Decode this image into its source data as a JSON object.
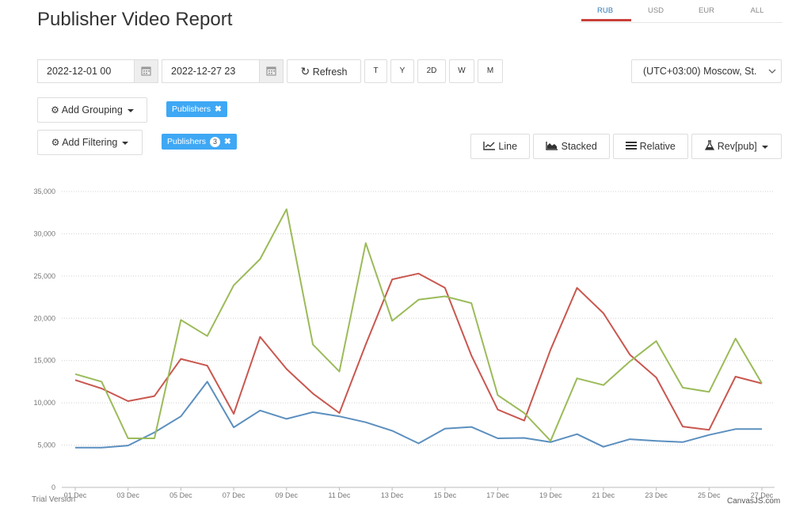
{
  "header": {
    "title": "Publisher Video Report"
  },
  "currency_tabs": [
    {
      "label": "RUB",
      "active": true
    },
    {
      "label": "USD",
      "active": false
    },
    {
      "label": "EUR",
      "active": false
    },
    {
      "label": "ALL",
      "active": false
    }
  ],
  "toolbar": {
    "date_from": "2022-12-01 00",
    "date_to": "2022-12-27 23",
    "refresh_label": "Refresh",
    "periods": [
      "T",
      "Y",
      "2D",
      "W",
      "M"
    ],
    "timezone": "(UTC+03:00) Moscow, St."
  },
  "grouping": {
    "button_label": "Add Grouping",
    "tag_label": "Publishers"
  },
  "filtering": {
    "button_label": "Add Filtering",
    "tag_label": "Publishers",
    "tag_count": "3"
  },
  "view_modes": {
    "line": "Line",
    "stacked": "Stacked",
    "relative": "Relative",
    "metric": "Rev[pub]"
  },
  "footer": {
    "trial": "Trial Version",
    "credit": "CanvasJS.com"
  },
  "colors": {
    "accent": "#c9403a",
    "tag_bg": "#3ea8f5",
    "link": "#337ab7"
  },
  "chart_data": {
    "type": "line",
    "x_tick_labels": [
      "01 Dec",
      "03 Dec",
      "05 Dec",
      "07 Dec",
      "09 Dec",
      "11 Dec",
      "13 Dec",
      "15 Dec",
      "17 Dec",
      "19 Dec",
      "21 Dec",
      "23 Dec",
      "25 Dec",
      "27 Dec"
    ],
    "y_tick_labels": [
      "0",
      "5,000",
      "10,000",
      "15,000",
      "20,000",
      "25,000",
      "30,000",
      "35,000"
    ],
    "ylim": [
      0,
      35000
    ],
    "grid": true,
    "x": [
      1,
      2,
      3,
      4,
      5,
      6,
      7,
      8,
      9,
      10,
      11,
      12,
      13,
      14,
      15,
      16,
      17,
      18,
      19,
      20,
      21,
      22,
      23,
      24,
      25,
      26,
      27
    ],
    "series": [
      {
        "color": "#5b8fbf",
        "values": [
          4700,
          4700,
          4950,
          6500,
          8400,
          12500,
          7100,
          9100,
          8100,
          8900,
          8400,
          7700,
          6700,
          5200,
          6950,
          7150,
          5800,
          5850,
          5350,
          6300,
          4800,
          5700,
          5500,
          5350,
          6200,
          6900,
          6900
        ]
      },
      {
        "color": "#c9574f",
        "values": [
          12700,
          11700,
          10200,
          10800,
          15200,
          14400,
          8700,
          17800,
          14000,
          11100,
          8800,
          16900,
          24600,
          25300,
          23600,
          15600,
          9200,
          7900,
          16300,
          23600,
          20600,
          15700,
          13000,
          7200,
          6800,
          13100,
          12300
        ]
      },
      {
        "color": "#9bbb59",
        "values": [
          13400,
          12500,
          5800,
          5800,
          19800,
          17900,
          23900,
          27000,
          32900,
          16900,
          13700,
          28900,
          19700,
          22200,
          22600,
          21800,
          10900,
          8800,
          5500,
          12900,
          12100,
          14900,
          17300,
          11800,
          11300,
          17600,
          12300
        ]
      }
    ]
  }
}
